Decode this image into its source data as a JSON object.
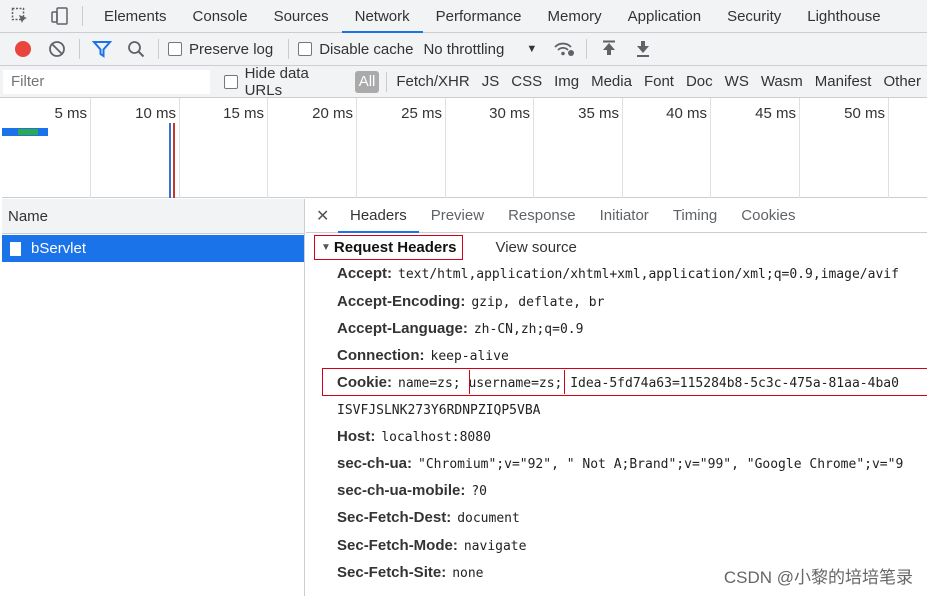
{
  "top_tabs": [
    "Elements",
    "Console",
    "Sources",
    "Network",
    "Performance",
    "Memory",
    "Application",
    "Security",
    "Lighthouse"
  ],
  "active_tab": "Network",
  "toolbar": {
    "preserve_log": "Preserve log",
    "disable_cache": "Disable cache",
    "throttling": "No throttling"
  },
  "filter": {
    "placeholder": "Filter",
    "hide_data_urls": "Hide data URLs",
    "all": "All",
    "types": [
      "Fetch/XHR",
      "JS",
      "CSS",
      "Img",
      "Media",
      "Font",
      "Doc",
      "WS",
      "Wasm",
      "Manifest",
      "Other"
    ]
  },
  "timeline_labels": [
    "5 ms",
    "10 ms",
    "15 ms",
    "20 ms",
    "25 ms",
    "30 ms",
    "35 ms",
    "40 ms",
    "45 ms",
    "50 ms"
  ],
  "request_list": {
    "column": "Name",
    "rows": [
      "bServlet"
    ]
  },
  "detail_tabs": [
    "Headers",
    "Preview",
    "Response",
    "Initiator",
    "Timing",
    "Cookies"
  ],
  "active_detail_tab": "Headers",
  "section": {
    "title": "Request Headers",
    "view_source": "View source"
  },
  "headers": [
    {
      "key": "Accept:",
      "value": "text/html,application/xhtml+xml,application/xml;q=0.9,image/avif"
    },
    {
      "key": "Accept-Encoding:",
      "value": "gzip, deflate, br"
    },
    {
      "key": "Accept-Language:",
      "value": "zh-CN,zh;q=0.9"
    },
    {
      "key": "Connection:",
      "value": "keep-alive"
    },
    {
      "key": "Cookie:",
      "value": "name=zs; username=zs; Idea-5fd74a63=115284b8-5c3c-475a-81aa-4ba0"
    },
    {
      "key": "",
      "value": "ISVFJSLNK273Y6RDNPZIQP5VBA"
    },
    {
      "key": "Host:",
      "value": "localhost:8080"
    },
    {
      "key": "sec-ch-ua:",
      "value": "\"Chromium\";v=\"92\", \" Not A;Brand\";v=\"99\", \"Google Chrome\";v=\"9"
    },
    {
      "key": "sec-ch-ua-mobile:",
      "value": "?0"
    },
    {
      "key": "Sec-Fetch-Dest:",
      "value": "document"
    },
    {
      "key": "Sec-Fetch-Mode:",
      "value": "navigate"
    },
    {
      "key": "Sec-Fetch-Site:",
      "value": "none"
    }
  ],
  "watermark": "CSDN @小黎的培培笔录",
  "colors": {
    "accent": "#1a73e8",
    "highlight": "#d0021b",
    "record": "#e8453c"
  }
}
